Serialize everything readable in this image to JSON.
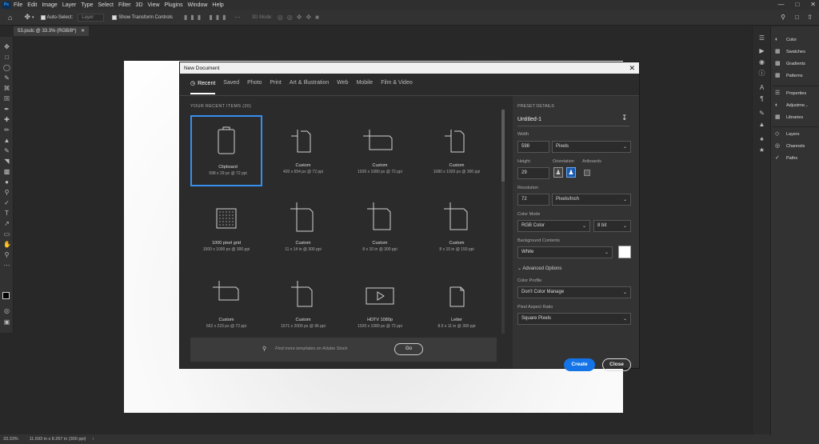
{
  "menubar": {
    "app_badge": "Ps",
    "items": [
      "File",
      "Edit",
      "Image",
      "Layer",
      "Type",
      "Select",
      "Filter",
      "3D",
      "View",
      "Plugins",
      "Window",
      "Help"
    ]
  },
  "options": {
    "auto_select": "Auto-Select:",
    "layer_select": "Layer",
    "show_transform": "Show Transform Controls",
    "mode_3d": "3D Mode:"
  },
  "document_tab": {
    "label": "53.psdc @ 33.3% (RGB/8*)"
  },
  "right_panels": {
    "group1": [
      "Color",
      "Swatches",
      "Gradients",
      "Patterns"
    ],
    "group2": [
      "Properties",
      "Adjustme...",
      "Libraries"
    ],
    "group3": [
      "Layers",
      "Channels",
      "Paths"
    ]
  },
  "status": {
    "zoom": "33.33%",
    "doc_info": "11.693 in x 8.267 in (300 ppi)"
  },
  "dialog": {
    "title": "New Document",
    "tabs": [
      "Recent",
      "Saved",
      "Photo",
      "Print",
      "Art & Illustration",
      "Web",
      "Mobile",
      "Film & Video"
    ],
    "recent_heading": "YOUR RECENT ITEMS  (20)",
    "items": [
      {
        "title": "Clipboard",
        "sub": "598 x 29 px @ 72 ppi",
        "icon": "clipboard-icon"
      },
      {
        "title": "Custom",
        "sub": "420 x 654 px @ 72 ppi",
        "icon": "custom-doc-icon"
      },
      {
        "title": "Custom",
        "sub": "1920 x 1080 px @ 72 ppi",
        "icon": "custom-landscape-icon"
      },
      {
        "title": "Custom",
        "sub": "1080 x 1920 px @ 300 ppi",
        "icon": "custom-doc-icon"
      },
      {
        "title": "1000 pixel grid",
        "sub": "1000 x 1000 px @ 300 ppi",
        "icon": "pixel-grid-icon"
      },
      {
        "title": "Custom",
        "sub": "11 x 14 in @ 300 ppi",
        "icon": "custom-doc-icon"
      },
      {
        "title": "Custom",
        "sub": "8 x 10 in @ 300 ppi",
        "icon": "custom-doc-icon"
      },
      {
        "title": "Custom",
        "sub": "8 x 10 in @ 150 ppi",
        "icon": "custom-doc-icon"
      },
      {
        "title": "Custom",
        "sub": "662 x 223 px @ 72 ppi",
        "icon": "custom-landscape-icon"
      },
      {
        "title": "Custom",
        "sub": "1571 x 2000 px @ 96 ppi",
        "icon": "custom-doc-icon"
      },
      {
        "title": "HDTV 1080p",
        "sub": "1920 x 1080 px @ 72 ppi",
        "icon": "video-icon"
      },
      {
        "title": "Letter",
        "sub": "8.5 x 11 in @ 300 ppi",
        "icon": "letter-icon"
      }
    ],
    "search_placeholder": "Find more templates on Adobe Stock",
    "go_label": "Go",
    "preset": {
      "heading": "PRESET DETAILS",
      "name": "Untitled-1",
      "width_label": "Width",
      "width_value": "598",
      "width_unit": "Pixels",
      "height_label": "Height",
      "height_value": "29",
      "orientation_label": "Orientation",
      "artboards_label": "Artboards",
      "resolution_label": "Resolution",
      "resolution_value": "72",
      "resolution_unit": "Pixels/Inch",
      "color_mode_label": "Color Mode",
      "color_mode_value": "RGB Color",
      "bit_depth": "8 bit",
      "bg_label": "Background Contents",
      "bg_value": "White",
      "advanced_label": "Advanced Options",
      "profile_label": "Color Profile",
      "profile_value": "Don't Color Manage",
      "aspect_label": "Pixel Aspect Ratio",
      "aspect_value": "Square Pixels"
    },
    "create_label": "Create",
    "close_label": "Close"
  }
}
